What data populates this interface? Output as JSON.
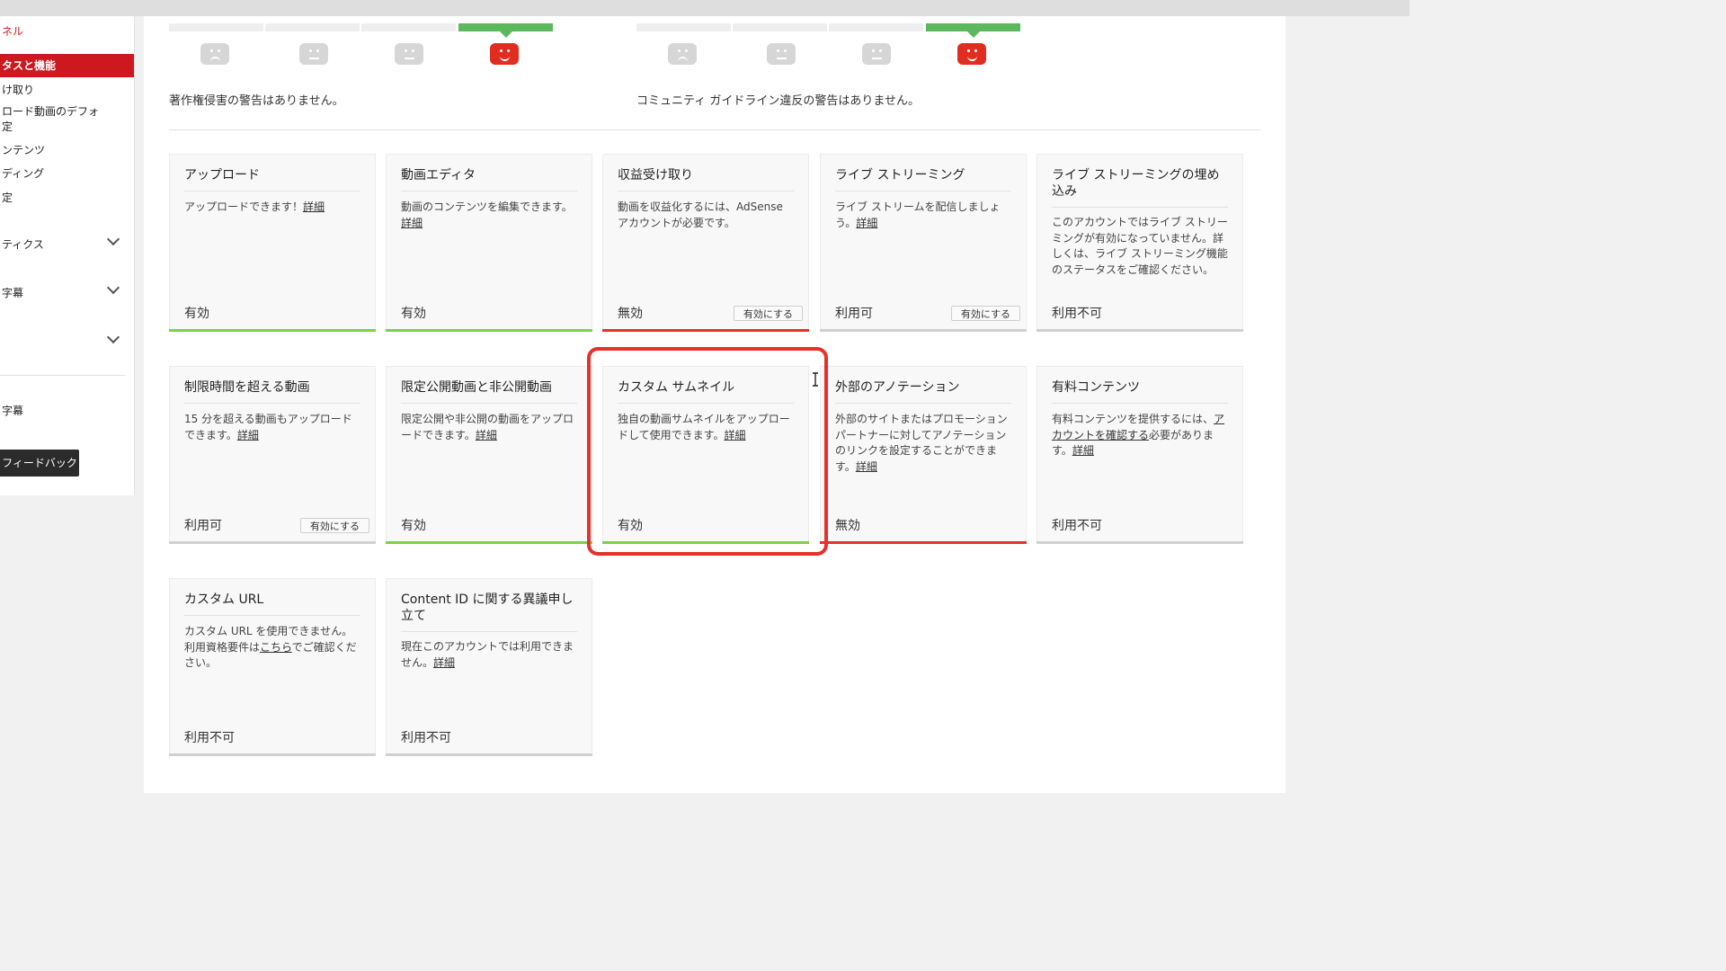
{
  "sidebar": {
    "title": "ネル",
    "items": [
      {
        "label": "タスと機能",
        "active": true
      },
      {
        "label": "け取り"
      },
      {
        "label": "ロード動画のデフォ"
      },
      {
        "label": "定"
      },
      {
        "label": "ンテンツ"
      },
      {
        "label": "ディング"
      },
      {
        "label": "定"
      },
      {
        "label": "ティクス",
        "expandable": true
      },
      {
        "label": "字幕",
        "expandable": true
      },
      {
        "label": "",
        "expandable": true
      },
      {
        "label": "字幕"
      }
    ],
    "feedback_label": "フィードバック"
  },
  "standing": {
    "copyright": {
      "message": "著作権侵害の警告はありません。",
      "faces": [
        "sad",
        "meh",
        "meh",
        "happy"
      ],
      "active_index": 3
    },
    "community": {
      "message": "コミュニティ ガイドライン違反の警告はありません。",
      "faces": [
        "sad",
        "meh",
        "meh",
        "happy"
      ],
      "active_index": 3
    }
  },
  "enable_label": "有効にする",
  "cards": [
    {
      "title": "アップロード",
      "desc": "アップロードできます！",
      "link": "詳細",
      "status": "有効",
      "bar": "green"
    },
    {
      "title": "動画エディタ",
      "desc": "動画のコンテンツを編集できます。",
      "link": "詳細",
      "status": "有効",
      "bar": "green"
    },
    {
      "title": "収益受け取り",
      "desc": "動画を収益化するには、AdSense アカウントが必要です。",
      "link": "",
      "status": "無効",
      "bar": "red",
      "button": true
    },
    {
      "title": "ライブ ストリーミング",
      "desc": "ライブ ストリームを配信しましょう。",
      "link": "詳細",
      "status": "利用可",
      "bar": "gray",
      "button": true
    },
    {
      "title": "ライブ ストリーミングの埋め込み",
      "desc": "このアカウントではライブ ストリーミングが有効になっていません。詳しくは、ライブ ストリーミング機能のステータスをご確認ください。",
      "link": "",
      "status": "利用不可",
      "bar": "gray"
    },
    {
      "title": "制限時間を超える動画",
      "desc": "15 分を超える動画もアップロードできます。",
      "link": "詳細",
      "status": "利用可",
      "bar": "gray",
      "button": true
    },
    {
      "title": "限定公開動画と非公開動画",
      "desc": "限定公開や非公開の動画をアップロードできます。",
      "link": "詳細",
      "status": "有効",
      "bar": "green"
    },
    {
      "title": "カスタム サムネイル",
      "desc": "独自の動画サムネイルをアップロードして使用できます。",
      "link": "詳細",
      "status": "有効",
      "bar": "green",
      "highlighted": true
    },
    {
      "title": "外部のアノテーション",
      "desc": "外部のサイトまたはプロモーション パートナーに対してアノテーションのリンクを設定することができます。",
      "link": "詳細",
      "status": "無効",
      "bar": "red"
    },
    {
      "title": "有料コンテンツ",
      "desc": "有料コンテンツを提供するには、",
      "link_inline": "アカウントを確認する",
      "desc_after": "必要があります。",
      "link": "詳細",
      "status": "利用不可",
      "bar": "gray"
    },
    {
      "title": "カスタム URL",
      "desc": "カスタム URL を使用できません。利用資格要件は",
      "link_inline": "こちら",
      "desc_after": "でご確認ください。",
      "link": "",
      "status": "利用不可",
      "bar": "gray"
    },
    {
      "title": "Content ID に関する異議申し立て",
      "desc": "現在このアカウントでは利用できません。",
      "link": "詳細",
      "status": "利用不可",
      "bar": "gray"
    }
  ],
  "colors": {
    "accent": "#cc181e",
    "green": "#7ed04b",
    "red": "#e0342c",
    "highlight": "#e5312a"
  }
}
